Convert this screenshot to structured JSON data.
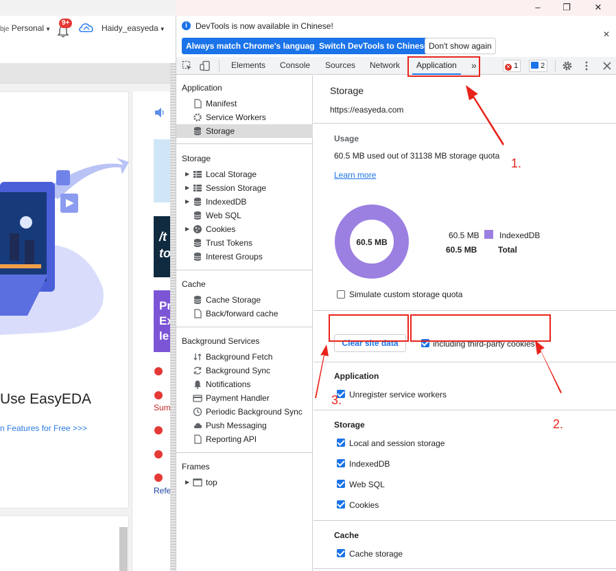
{
  "browser": {
    "window_controls": {
      "minimize": "–",
      "maximize": "❐",
      "close": "✕"
    }
  },
  "site": {
    "workspace_label": "Personal",
    "workspace_prefix": "bje",
    "notification_badge": "9+",
    "user_name": "Haidy_easyeda",
    "hero_title": "Use EasyEDA",
    "feature_link": "n Features for Free >>>",
    "banner2_text": "/t\nto",
    "banner3_text": "Pr\nEx\nle",
    "red_text_1": "Sum",
    "blue_text_1": "Refe"
  },
  "devtools": {
    "infobar": {
      "message": "DevTools is now available in Chinese!",
      "btn_match": "Always match Chrome's language",
      "btn_switch": "Switch DevTools to Chinese",
      "btn_dont": "Don't show again",
      "close": "✕"
    },
    "tabs": [
      "Elements",
      "Console",
      "Sources",
      "Network",
      "Application"
    ],
    "more_tabs": "»",
    "error_count": "1",
    "message_count": "2",
    "sidebar": {
      "application_heading": "Application",
      "application_items": [
        "Manifest",
        "Service Workers",
        "Storage"
      ],
      "storage_heading": "Storage",
      "storage_items": [
        "Local Storage",
        "Session Storage",
        "IndexedDB",
        "Web SQL",
        "Cookies",
        "Trust Tokens",
        "Interest Groups"
      ],
      "cache_heading": "Cache",
      "cache_items": [
        "Cache Storage",
        "Back/forward cache"
      ],
      "background_heading": "Background Services",
      "background_items": [
        "Background Fetch",
        "Background Sync",
        "Notifications",
        "Payment Handler",
        "Periodic Background Sync",
        "Push Messaging",
        "Reporting API"
      ],
      "frames_heading": "Frames",
      "frames_items": [
        "top"
      ]
    },
    "storage_panel": {
      "title": "Storage",
      "origin": "https://easyeda.com",
      "usage_heading": "Usage",
      "usage_text": "60.5 MB used out of 31138 MB storage quota",
      "learn_more": "Learn more",
      "donut_label": "60.5 MB",
      "donut_color": "#9b7fe1",
      "legend": [
        {
          "value": "60.5 MB",
          "label": "IndexedDB"
        },
        {
          "value": "60.5 MB",
          "label": "Total"
        }
      ],
      "simulate_quota": "Simulate custom storage quota",
      "simulate_checked": false,
      "clear_button": "Clear site data",
      "third_party": "including third-party cookies",
      "third_party_checked": true,
      "application_heading": "Application",
      "unregister_sw": "Unregister service workers",
      "storage_heading": "Storage",
      "storage_options": [
        "Local and session storage",
        "IndexedDB",
        "Web SQL",
        "Cookies"
      ],
      "cache_heading": "Cache",
      "cache_options": [
        "Cache storage"
      ]
    }
  },
  "annotations": {
    "label_1": "1.",
    "label_2": "2.",
    "label_3": "3.",
    "color": "#e8231b"
  }
}
